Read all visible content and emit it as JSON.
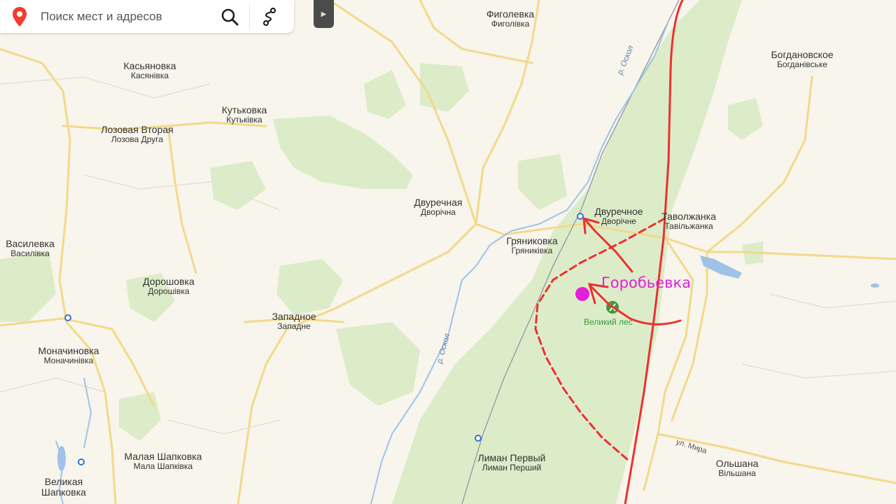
{
  "search": {
    "placeholder": "Поиск мест и адресов"
  },
  "icons": {
    "pin": "location-pin-icon",
    "search": "search-icon",
    "routes": "route-icon",
    "collapse": "play-triangle-icon"
  },
  "colors": {
    "accent_red": "#ee2f2f",
    "pin_magenta": "#e41fd8",
    "forest_green": "#3b9a3b",
    "river_blue": "#9fc3e8"
  },
  "places": [
    {
      "ru": "Фиголевка",
      "ua": "Фиголівка"
    },
    {
      "ru": "Касьяновка",
      "ua": "Касянівка"
    },
    {
      "ru": "Кутьковка",
      "ua": "Кутьківка"
    },
    {
      "ru": "Лозовая Вторая",
      "ua": "Лозова Друга"
    },
    {
      "ru": "Богдановское",
      "ua": "Богданівське"
    },
    {
      "ru": "Двуречная",
      "ua": "Дворічна"
    },
    {
      "ru": "Двуречное",
      "ua": "Дворічне"
    },
    {
      "ru": "Таволжанка",
      "ua": "Тавільжанка"
    },
    {
      "ru": "Гряниковка",
      "ua": "Гряниківка"
    },
    {
      "ru": "Василевка",
      "ua": "Василівка"
    },
    {
      "ru": "Дорошовка",
      "ua": "Дорошівка"
    },
    {
      "ru": "Западное",
      "ua": "Западне"
    },
    {
      "ru": "Моначиновка",
      "ua": "Моначинівка"
    },
    {
      "ru": "Малая Шапковка",
      "ua": "Мала Шапківка"
    },
    {
      "ru": "Лиман Первый",
      "ua": "Лиман Перший"
    },
    {
      "ru": "Ольшана",
      "ua": "Вільшана"
    },
    {
      "ru": "Великая Шапковка",
      "ua": ""
    }
  ],
  "annotation": {
    "label": "Горобьевка"
  },
  "forest": {
    "label": "Великий лес"
  },
  "rivers": [
    {
      "label": "р. Оскол"
    },
    {
      "label": "р. Оскол"
    }
  ],
  "street": {
    "label": "ул. Мира"
  }
}
